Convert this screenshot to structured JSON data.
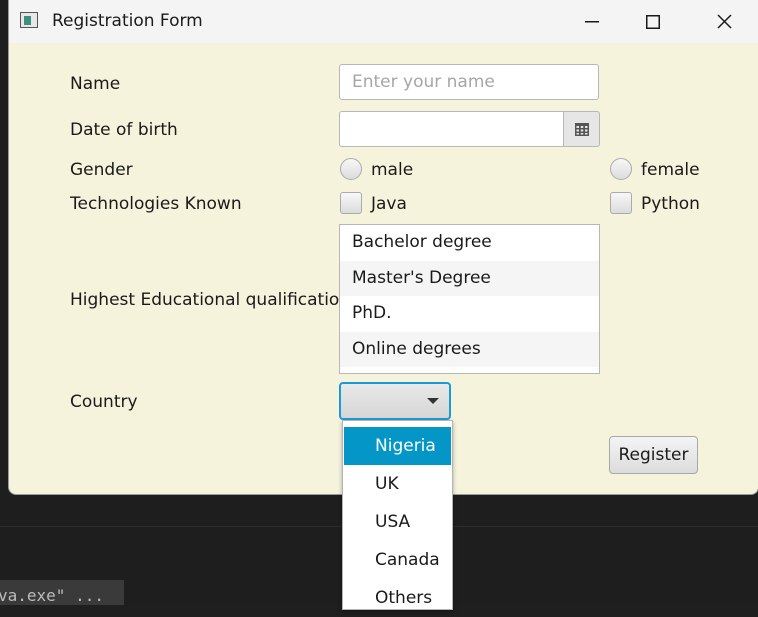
{
  "window": {
    "title": "Registration Form"
  },
  "form": {
    "name_label": "Name",
    "name_placeholder": "Enter your name",
    "dob_label": "Date of birth",
    "gender_label": "Gender",
    "gender_options": [
      "male",
      "female"
    ],
    "tech_label": "Technologies Known",
    "tech_options": [
      "Java",
      "Python"
    ],
    "qualification_label": "Highest Educational qualification",
    "qualifications": [
      "Bachelor degree",
      "Master's Degree",
      "PhD.",
      "Online degrees"
    ],
    "country_label": "Country",
    "country_selected": "",
    "country_options": [
      "Nigeria",
      "UK",
      "USA",
      "Canada",
      "Others"
    ],
    "country_highlighted": "Nigeria",
    "register_label": "Register"
  },
  "background": {
    "terminal_text": "va.exe\" ..."
  },
  "colors": {
    "form_background": "#f5f3dc",
    "selection_accent": "#0596c8",
    "focus_border": "#1a9ad6"
  }
}
